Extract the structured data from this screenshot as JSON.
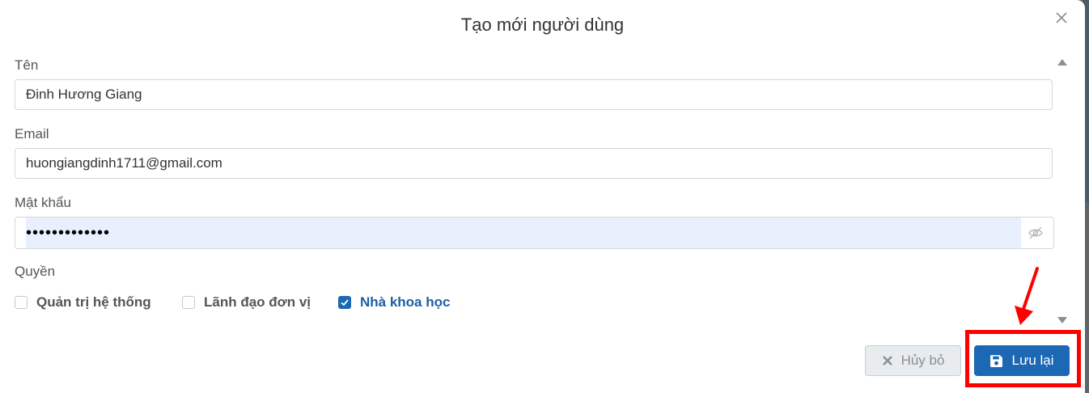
{
  "dialog": {
    "title": "Tạo mới người dùng",
    "close_icon": "close-icon"
  },
  "form": {
    "name_label": "Tên",
    "name_value": "Đinh Hương Giang",
    "email_label": "Email",
    "email_value": "huongiangdinh1711@gmail.com",
    "password_label": "Mật khẩu",
    "password_value": "•••••••••••••",
    "password_toggle_icon": "eye-slash-icon",
    "roles_label": "Quyền",
    "roles": [
      {
        "label": "Quản trị hệ thống",
        "checked": false
      },
      {
        "label": "Lãnh đạo đơn vị",
        "checked": false
      },
      {
        "label": "Nhà khoa học",
        "checked": true
      }
    ]
  },
  "footer": {
    "cancel_label": "Hủy bỏ",
    "cancel_icon": "x-icon",
    "save_label": "Lưu lại",
    "save_icon": "floppy-disk-icon"
  },
  "annotation": {
    "highlight_color": "#ff0000",
    "target": "save-button"
  },
  "colors": {
    "primary": "#1c68b4",
    "autofill": "#e8f0fe"
  }
}
